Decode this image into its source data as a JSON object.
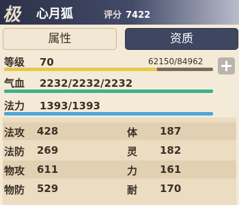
{
  "header": {
    "grade": "极",
    "pet_name": "心月狐",
    "score_label": "评分",
    "score_value": "7422"
  },
  "tabs": [
    {
      "label": "属性",
      "active": false
    },
    {
      "label": "资质",
      "active": true
    }
  ],
  "level": {
    "label": "等级",
    "value": "70",
    "exp_text": "62150/84962",
    "exp_fraction": 0.7315
  },
  "hp": {
    "label": "气血",
    "value": "2232/2232/2232",
    "fraction": 1.0
  },
  "mp": {
    "label": "法力",
    "value": "1393/1393",
    "fraction": 1.0
  },
  "stats": [
    {
      "left_label": "法攻",
      "left_value": "428",
      "right_label": "体",
      "right_value": "187"
    },
    {
      "left_label": "法防",
      "left_value": "269",
      "right_label": "灵",
      "right_value": "182"
    },
    {
      "left_label": "物攻",
      "left_value": "611",
      "right_label": "力",
      "right_value": "161"
    },
    {
      "left_label": "物防",
      "left_value": "529",
      "right_label": "耐",
      "right_value": "170"
    }
  ],
  "colors": {
    "exp_bar": "#e6c84a",
    "hp_bar": "#3fb08a",
    "mp_bar": "#4aa6d8",
    "header_dark": "#2c3147"
  },
  "icons": {
    "add": "plus-icon"
  }
}
